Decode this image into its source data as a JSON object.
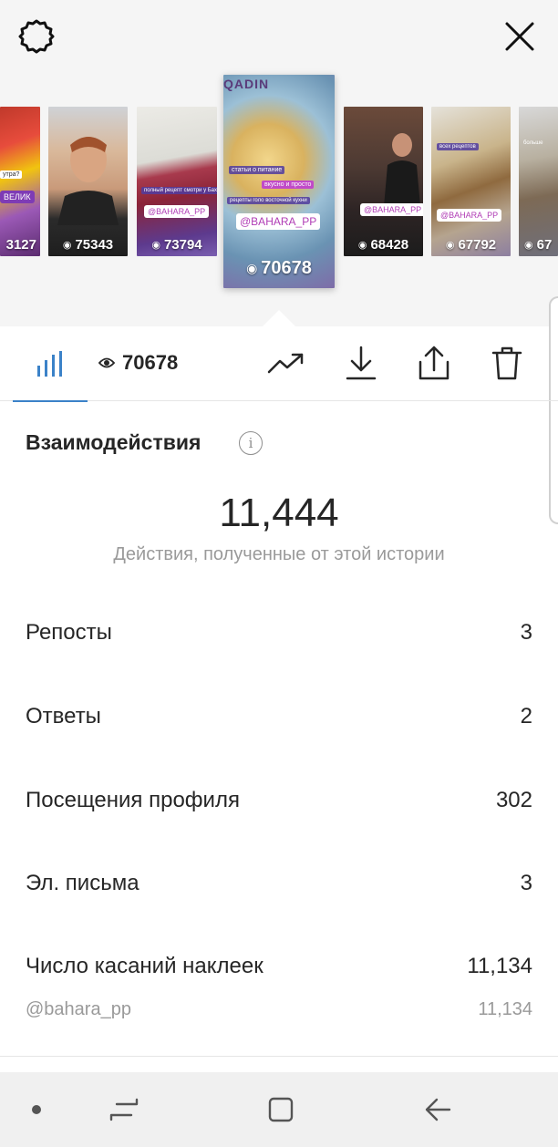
{
  "stories": [
    {
      "views": "3127",
      "sticker": "ВЕЛИК",
      "note": "утра?"
    },
    {
      "views": "75343"
    },
    {
      "views": "73794",
      "sticker": "@BAHARA_PP",
      "note": "полный рецепт смотри у Бахары"
    },
    {
      "views": "70678",
      "sticker": "@BAHARA_PP",
      "note": "статьи о питание",
      "note2": "вкусно и просто",
      "note3": "рецепты голо восточной кухни",
      "top_text": "QADIN"
    },
    {
      "views": "68428",
      "sticker": "@BAHARA_PP"
    },
    {
      "views": "67792",
      "sticker": "@BAHARA_PP",
      "note": "всех рецептов"
    },
    {
      "views": "67",
      "note": "больше"
    }
  ],
  "toolbar": {
    "views": "70678"
  },
  "interactions": {
    "title": "Взаимодействия",
    "info": "i",
    "total": "11,444",
    "caption": "Действия, полученные от этой истории",
    "rows": [
      {
        "label": "Репосты",
        "value": "3"
      },
      {
        "label": "Ответы",
        "value": "2"
      },
      {
        "label": "Посещения профиля",
        "value": "302"
      },
      {
        "label": "Эл. письма",
        "value": "3"
      },
      {
        "label": "Число касаний наклеек",
        "value": "11,134"
      }
    ],
    "sub_row": {
      "label": "@bahara_pp",
      "value": "11,134"
    }
  },
  "icons": {
    "settings": "settings-icon",
    "close": "close-icon",
    "chart": "bar-chart-icon",
    "eye": "eye-icon",
    "trend": "trending-up-icon",
    "download": "download-icon",
    "share": "share-icon",
    "delete": "trash-icon"
  },
  "colors": {
    "accent": "#3b82c8",
    "muted": "#9a9a9a",
    "text": "#262626"
  }
}
